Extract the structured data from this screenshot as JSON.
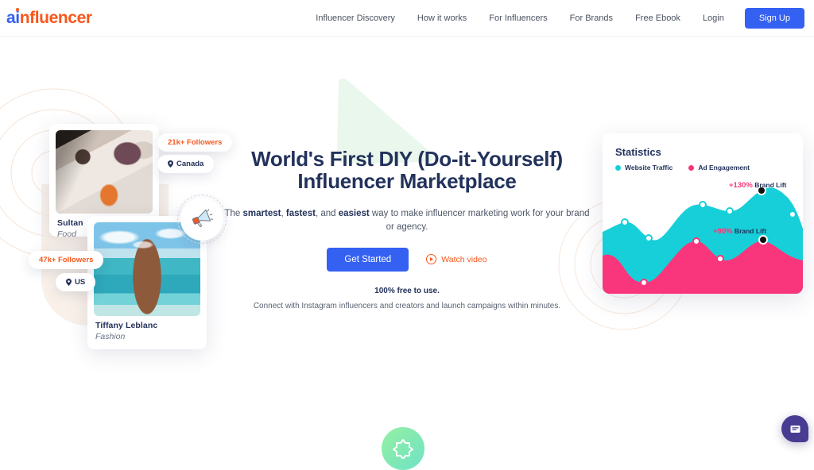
{
  "brand": {
    "logo_a": "a",
    "logo_i": "i",
    "logo_rest": "nfluencer",
    "color_blue": "#3461f2",
    "color_orange": "#f8571d"
  },
  "header": {
    "nav": [
      {
        "label": "Influencer Discovery"
      },
      {
        "label": "How it works"
      },
      {
        "label": "For Influencers"
      },
      {
        "label": "For Brands"
      },
      {
        "label": "Free Ebook"
      },
      {
        "label": "Login"
      }
    ],
    "signup_label": "Sign Up"
  },
  "hero": {
    "title_line1": "World's First DIY (Do-it-Yourself)",
    "title_line2": "Influencer Marketplace",
    "sub_pre": "The ",
    "sub_b1": "smartest",
    "sub_mid1": ", ",
    "sub_b2": "fastest",
    "sub_mid2": ", and ",
    "sub_b3": "easiest",
    "sub_post": " way to make influencer marketing work for your brand or agency.",
    "cta_primary": "Get Started",
    "cta_video": "Watch video",
    "free_note": "100% free to use.",
    "connect_note": "Connect with Instagram influencers and creators and launch campaigns within minutes."
  },
  "influencer_cards": [
    {
      "name": "Sultan",
      "category": "Food",
      "followers": "21k+ Followers",
      "location": "Canada",
      "pin_glyph": "☉"
    },
    {
      "name": "Tiffany Leblanc",
      "category": "Fashion",
      "followers": "47k+ Followers",
      "location": "US",
      "pin_glyph": "☉"
    }
  ],
  "stats_card": {
    "title": "Statistics",
    "annotations": [
      {
        "pct": "+130%",
        "label": " Brand Lift"
      },
      {
        "pct": "+90%",
        "label": " Brand Lift"
      }
    ]
  },
  "chart_data": {
    "type": "area",
    "title": "Statistics",
    "xlabel": "",
    "ylabel": "",
    "grid": false,
    "legend_position": "top-left",
    "x": [
      0,
      1,
      2,
      3,
      4,
      5,
      6,
      7
    ],
    "ylim": [
      0,
      100
    ],
    "series": [
      {
        "name": "Website Traffic",
        "color": "#17cfd8",
        "values": [
          44,
          52,
          34,
          40,
          68,
          66,
          63,
          90,
          42
        ],
        "markers": [
          {
            "x": 1,
            "y": 52,
            "style": "open"
          },
          {
            "x": 2,
            "y": 34,
            "style": "open"
          },
          {
            "x": 4,
            "y": 68,
            "style": "open"
          },
          {
            "x": 5,
            "y": 63,
            "style": "open"
          },
          {
            "x": 7,
            "y": 90,
            "style": "filled"
          },
          {
            "x": 8,
            "y": 42,
            "style": "open"
          }
        ]
      },
      {
        "name": "Ad Engagement",
        "color": "#f9367c",
        "values": [
          26,
          22,
          6,
          16,
          40,
          45,
          30,
          56,
          26
        ],
        "markers": [
          {
            "x": 1,
            "y": 6,
            "style": "open"
          },
          {
            "x": 4,
            "y": 45,
            "style": "open"
          },
          {
            "x": 5,
            "y": 30,
            "style": "open"
          },
          {
            "x": 7,
            "y": 56,
            "style": "filled"
          }
        ]
      }
    ],
    "annotations": [
      {
        "text": "+130% Brand Lift",
        "value": 130,
        "attached_series": "Website Traffic",
        "x": 7
      },
      {
        "text": "+90% Brand Lift",
        "value": 90,
        "attached_series": "Ad Engagement",
        "x": 7
      }
    ]
  },
  "chat_widget": {
    "icon": "chat-bubble-icon",
    "color": "#473b92"
  },
  "decor": {
    "badge_icon": "star-badge-icon",
    "megaphone_icon": "megaphone-icon"
  }
}
